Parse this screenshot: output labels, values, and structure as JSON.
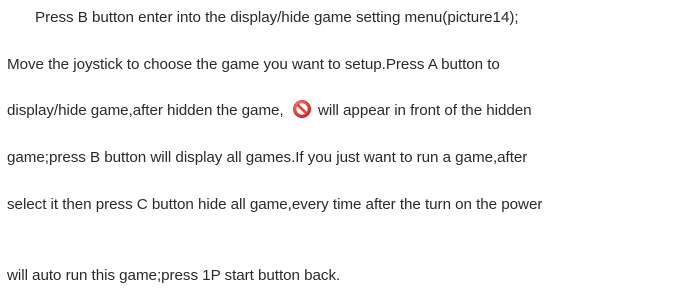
{
  "paragraph": {
    "line1": "Press B button enter into the display/hide game setting menu(picture14);",
    "line2": "Move the joystick to choose the game you want to setup.Press A button to",
    "line3_before_icon": "display/hide game,after hidden the game,",
    "line3_after_icon": " will appear in front of the hidden",
    "line4": "game;press B button will display all games.If you just want to run a game,after",
    "line5": "select it then press C button hide all game,every time after the turn on the power",
    "line6": "will auto run this game;press 1P start button back."
  },
  "icons": {
    "hidden_marker": "forbidden-icon"
  },
  "colors": {
    "text": "#2a2a2a",
    "icon_red": "#e8433b",
    "icon_white": "#ffffff",
    "background": "#ffffff"
  }
}
